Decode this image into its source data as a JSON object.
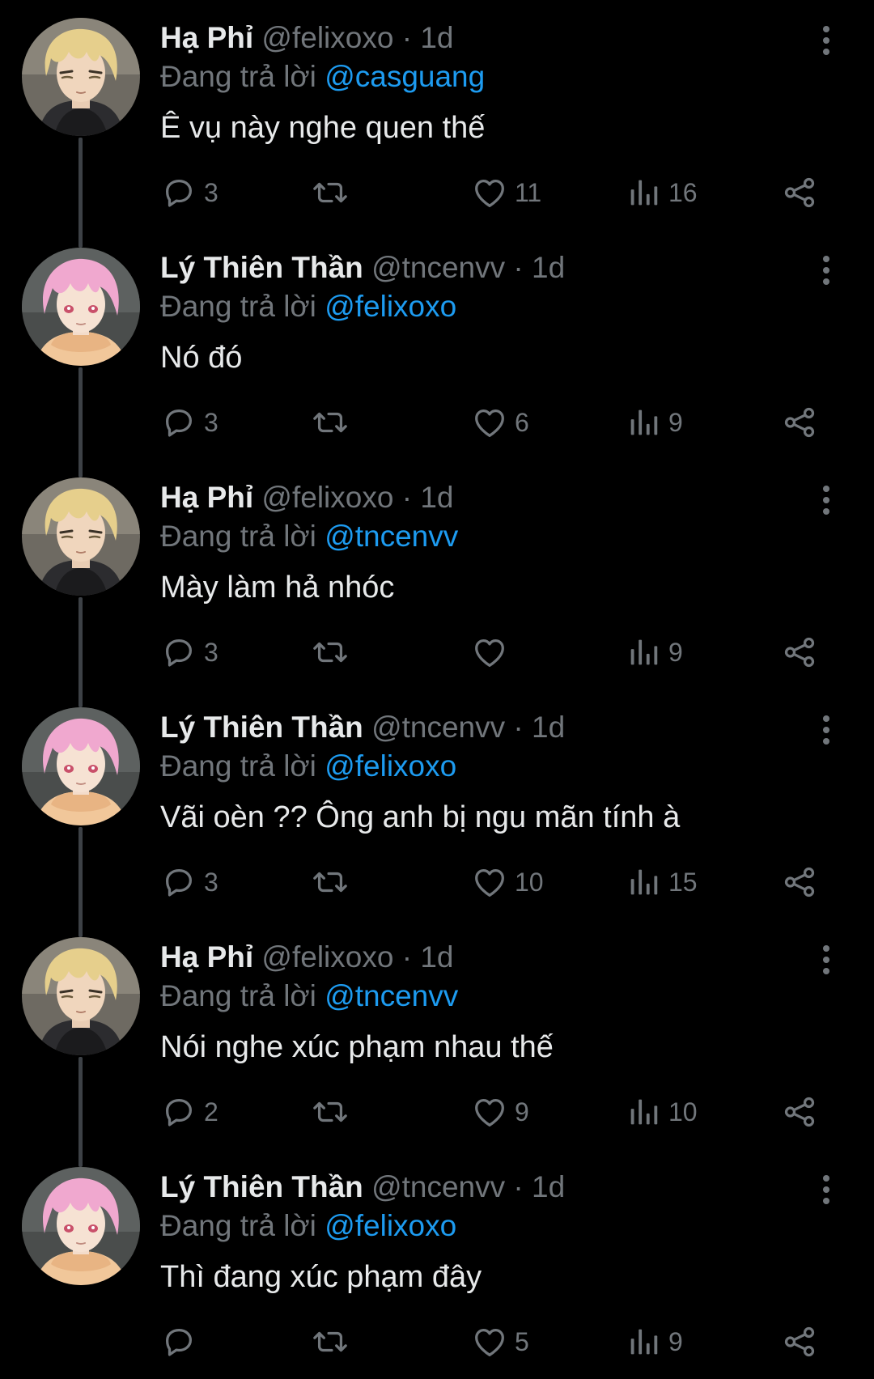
{
  "thread": {
    "replying_prefix": "Đang trả lời",
    "tweets": [
      {
        "name": "Hạ Phỉ",
        "handle": "@felixoxo",
        "sep": "·",
        "time": "1d",
        "replying_to": "@casguang",
        "text": "Ê vụ này nghe quen thế",
        "replies": "3",
        "retweets": "",
        "likes": "11",
        "views": "16",
        "avatar_icon": "anime-blond-avatar"
      },
      {
        "name": "Lý Thiên Thần",
        "handle": "@tncenvv",
        "sep": "·",
        "time": "1d",
        "replying_to": "@felixoxo",
        "text": "Nó đó",
        "replies": "3",
        "retweets": "",
        "likes": "6",
        "views": "9",
        "avatar_icon": "anime-pink-avatar"
      },
      {
        "name": "Hạ Phỉ",
        "handle": "@felixoxo",
        "sep": "·",
        "time": "1d",
        "replying_to": "@tncenvv",
        "text": "Mày làm hả nhóc",
        "replies": "3",
        "retweets": "",
        "likes": "",
        "views": "9",
        "avatar_icon": "anime-blond-avatar"
      },
      {
        "name": "Lý Thiên Thần",
        "handle": "@tncenvv",
        "sep": "·",
        "time": "1d",
        "replying_to": "@felixoxo",
        "text": "Vãi oèn ?? Ông anh bị ngu mãn tính à",
        "replies": "3",
        "retweets": "",
        "likes": "10",
        "views": "15",
        "avatar_icon": "anime-pink-avatar"
      },
      {
        "name": "Hạ Phỉ",
        "handle": "@felixoxo",
        "sep": "·",
        "time": "1d",
        "replying_to": "@tncenvv",
        "text": "Nói nghe xúc phạm nhau thế",
        "replies": "2",
        "retweets": "",
        "likes": "9",
        "views": "10",
        "avatar_icon": "anime-blond-avatar"
      },
      {
        "name": "Lý Thiên Thần",
        "handle": "@tncenvv",
        "sep": "·",
        "time": "1d",
        "replying_to": "@felixoxo",
        "text": "Thì đang xúc phạm đây",
        "replies": "",
        "retweets": "",
        "likes": "5",
        "views": "9",
        "avatar_icon": "anime-pink-avatar"
      }
    ]
  },
  "icons": {
    "reply": "reply-icon",
    "retweet": "retweet-icon",
    "like": "heart-icon",
    "views": "views-icon",
    "share": "share-icon",
    "more": "more-vertical-icon"
  },
  "colors": {
    "background": "#000000",
    "text_primary": "#e7e9ea",
    "text_secondary": "#71767b",
    "mention": "#1d9bf0",
    "thread_line": "#3d4146"
  }
}
